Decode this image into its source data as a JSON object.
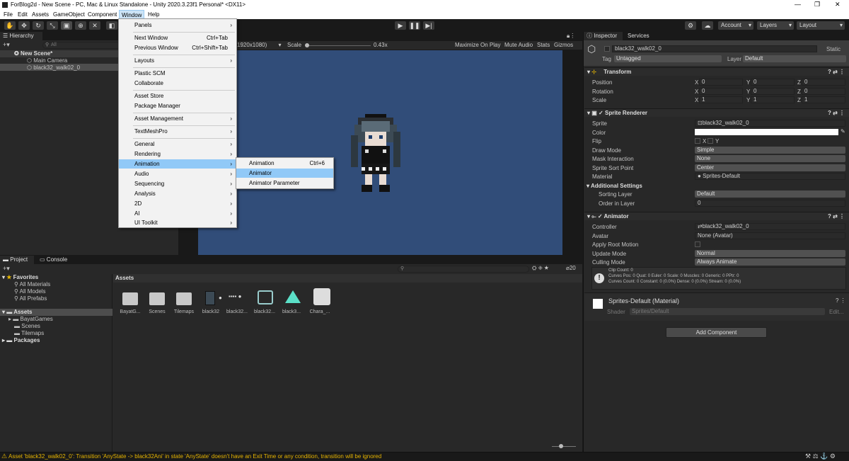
{
  "window": {
    "title": "ForBlog2d - New Scene - PC, Mac & Linux Standalone - Unity 2020.3.23f1 Personal* <DX11>",
    "min": "—",
    "max": "❐",
    "close": "✕"
  },
  "menubar": [
    "File",
    "Edit",
    "Assets",
    "GameObject",
    "Component",
    "Window",
    "Help"
  ],
  "toolbar": {
    "account": "Account",
    "layers": "Layers",
    "layout": "Layout"
  },
  "hierarchy": {
    "tab": "Hierarchy",
    "search_placeholder": "All",
    "scene": "New Scene*",
    "items": [
      "Main Camera",
      "black32_walk02_0"
    ]
  },
  "game_view": {
    "resolution": "1920x1080)",
    "scale_label": "Scale",
    "scale_value": "0.43x",
    "buttons": [
      "Maximize On Play",
      "Mute Audio",
      "Stats",
      "Gizmos"
    ]
  },
  "window_menu": {
    "items": [
      {
        "label": "Panels",
        "shortcut": "",
        "arrow": true
      },
      {
        "label": "Next Window",
        "shortcut": "Ctrl+Tab",
        "arrow": false
      },
      {
        "label": "Previous Window",
        "shortcut": "Ctrl+Shift+Tab",
        "arrow": false
      },
      {
        "label": "Layouts",
        "shortcut": "",
        "arrow": true
      },
      {
        "label": "Plastic SCM",
        "shortcut": "",
        "arrow": false
      },
      {
        "label": "Collaborate",
        "shortcut": "",
        "arrow": false
      },
      {
        "label": "Asset Store",
        "shortcut": "",
        "arrow": false
      },
      {
        "label": "Package Manager",
        "shortcut": "",
        "arrow": false
      },
      {
        "label": "Asset Management",
        "shortcut": "",
        "arrow": true
      },
      {
        "label": "TextMeshPro",
        "shortcut": "",
        "arrow": true
      },
      {
        "label": "General",
        "shortcut": "",
        "arrow": true
      },
      {
        "label": "Rendering",
        "shortcut": "",
        "arrow": true
      },
      {
        "label": "Animation",
        "shortcut": "",
        "arrow": true
      },
      {
        "label": "Audio",
        "shortcut": "",
        "arrow": true
      },
      {
        "label": "Sequencing",
        "shortcut": "",
        "arrow": true
      },
      {
        "label": "Analysis",
        "shortcut": "",
        "arrow": true
      },
      {
        "label": "2D",
        "shortcut": "",
        "arrow": true
      },
      {
        "label": "AI",
        "shortcut": "",
        "arrow": true
      },
      {
        "label": "UI Toolkit",
        "shortcut": "",
        "arrow": true
      }
    ]
  },
  "animation_submenu": {
    "items": [
      {
        "label": "Animation",
        "shortcut": "Ctrl+6"
      },
      {
        "label": "Animator",
        "shortcut": ""
      },
      {
        "label": "Animator Parameter",
        "shortcut": ""
      }
    ]
  },
  "project": {
    "tabs": [
      "Project",
      "Console"
    ],
    "favorites": "Favorites",
    "fav_items": [
      "All Materials",
      "All Models",
      "All Prefabs"
    ],
    "assets_root": "Assets",
    "asset_folders": [
      "BayatGames",
      "Scenes",
      "Tilemaps"
    ],
    "packages": "Packages",
    "breadcrumb": "Assets",
    "hidden_count": "20",
    "grid": [
      "BayatG...",
      "Scenes",
      "Tilemaps",
      "black32",
      "black32...",
      "black32...",
      "black3...",
      "Chara_..."
    ]
  },
  "inspector": {
    "tabs": [
      "Inspector",
      "Services"
    ],
    "object_name": "black32_walk02_0",
    "static": "Static",
    "tag_label": "Tag",
    "tag_value": "Untagged",
    "layer_label": "Layer",
    "layer_value": "Default",
    "transform": {
      "title": "Transform",
      "position": {
        "label": "Position",
        "x": "0",
        "y": "0",
        "z": "0"
      },
      "rotation": {
        "label": "Rotation",
        "x": "0",
        "y": "0",
        "z": "0"
      },
      "scale": {
        "label": "Scale",
        "x": "1",
        "y": "1",
        "z": "1"
      }
    },
    "sprite_renderer": {
      "title": "Sprite Renderer",
      "sprite_label": "Sprite",
      "sprite": "black32_walk02_0",
      "color_label": "Color",
      "flip_label": "Flip",
      "flip_x": "X",
      "flip_y": "Y",
      "draw_mode_label": "Draw Mode",
      "draw_mode": "Simple",
      "mask_label": "Mask Interaction",
      "mask": "None",
      "sort_point_label": "Sprite Sort Point",
      "sort_point": "Center",
      "material_label": "Material",
      "material": "Sprites-Default",
      "additional": "Additional Settings",
      "sorting_layer_label": "Sorting Layer",
      "sorting_layer": "Default",
      "order_label": "Order in Layer",
      "order": "0"
    },
    "animator": {
      "title": "Animator",
      "controller_label": "Controller",
      "controller": "black32_walk02_0",
      "avatar_label": "Avatar",
      "avatar": "None (Avatar)",
      "root_motion_label": "Apply Root Motion",
      "update_label": "Update Mode",
      "update": "Normal",
      "culling_label": "Culling Mode",
      "culling": "Always Animate",
      "info1": "Clip Count: 0",
      "info2": "Curves Pos: 0 Quat: 0 Euler: 0 Scale: 0 Muscles: 0 Generic: 0 PPtr: 0",
      "info3": "Curves Count: 0 Constant: 0 (0.0%) Dense: 0 (0.0%) Stream: 0 (0.0%)"
    },
    "material": {
      "title": "Sprites-Default (Material)",
      "shader_label": "Shader",
      "shader": "Sprites/Default",
      "edit": "Edit..."
    },
    "add_component": "Add Component"
  },
  "status": {
    "message": "Asset 'black32_walk02_0': Transition 'AnyState -> black32Ani' in state 'AnyState' doesn't have an Exit Time or any condition, transition will be ignored"
  },
  "colors": {
    "game_bg": "#314d79",
    "highlight": "#91c9f7"
  }
}
